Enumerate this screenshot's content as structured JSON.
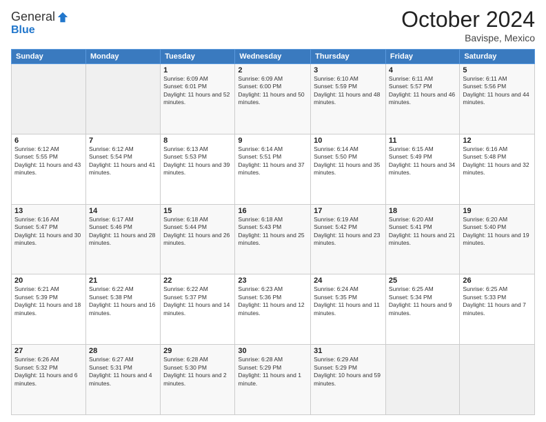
{
  "header": {
    "logo_general": "General",
    "logo_blue": "Blue",
    "month": "October 2024",
    "location": "Bavispe, Mexico"
  },
  "days_of_week": [
    "Sunday",
    "Monday",
    "Tuesday",
    "Wednesday",
    "Thursday",
    "Friday",
    "Saturday"
  ],
  "weeks": [
    [
      {
        "day": "",
        "sunrise": "",
        "sunset": "",
        "daylight": ""
      },
      {
        "day": "",
        "sunrise": "",
        "sunset": "",
        "daylight": ""
      },
      {
        "day": "1",
        "sunrise": "Sunrise: 6:09 AM",
        "sunset": "Sunset: 6:01 PM",
        "daylight": "Daylight: 11 hours and 52 minutes."
      },
      {
        "day": "2",
        "sunrise": "Sunrise: 6:09 AM",
        "sunset": "Sunset: 6:00 PM",
        "daylight": "Daylight: 11 hours and 50 minutes."
      },
      {
        "day": "3",
        "sunrise": "Sunrise: 6:10 AM",
        "sunset": "Sunset: 5:59 PM",
        "daylight": "Daylight: 11 hours and 48 minutes."
      },
      {
        "day": "4",
        "sunrise": "Sunrise: 6:11 AM",
        "sunset": "Sunset: 5:57 PM",
        "daylight": "Daylight: 11 hours and 46 minutes."
      },
      {
        "day": "5",
        "sunrise": "Sunrise: 6:11 AM",
        "sunset": "Sunset: 5:56 PM",
        "daylight": "Daylight: 11 hours and 44 minutes."
      }
    ],
    [
      {
        "day": "6",
        "sunrise": "Sunrise: 6:12 AM",
        "sunset": "Sunset: 5:55 PM",
        "daylight": "Daylight: 11 hours and 43 minutes."
      },
      {
        "day": "7",
        "sunrise": "Sunrise: 6:12 AM",
        "sunset": "Sunset: 5:54 PM",
        "daylight": "Daylight: 11 hours and 41 minutes."
      },
      {
        "day": "8",
        "sunrise": "Sunrise: 6:13 AM",
        "sunset": "Sunset: 5:53 PM",
        "daylight": "Daylight: 11 hours and 39 minutes."
      },
      {
        "day": "9",
        "sunrise": "Sunrise: 6:14 AM",
        "sunset": "Sunset: 5:51 PM",
        "daylight": "Daylight: 11 hours and 37 minutes."
      },
      {
        "day": "10",
        "sunrise": "Sunrise: 6:14 AM",
        "sunset": "Sunset: 5:50 PM",
        "daylight": "Daylight: 11 hours and 35 minutes."
      },
      {
        "day": "11",
        "sunrise": "Sunrise: 6:15 AM",
        "sunset": "Sunset: 5:49 PM",
        "daylight": "Daylight: 11 hours and 34 minutes."
      },
      {
        "day": "12",
        "sunrise": "Sunrise: 6:16 AM",
        "sunset": "Sunset: 5:48 PM",
        "daylight": "Daylight: 11 hours and 32 minutes."
      }
    ],
    [
      {
        "day": "13",
        "sunrise": "Sunrise: 6:16 AM",
        "sunset": "Sunset: 5:47 PM",
        "daylight": "Daylight: 11 hours and 30 minutes."
      },
      {
        "day": "14",
        "sunrise": "Sunrise: 6:17 AM",
        "sunset": "Sunset: 5:46 PM",
        "daylight": "Daylight: 11 hours and 28 minutes."
      },
      {
        "day": "15",
        "sunrise": "Sunrise: 6:18 AM",
        "sunset": "Sunset: 5:44 PM",
        "daylight": "Daylight: 11 hours and 26 minutes."
      },
      {
        "day": "16",
        "sunrise": "Sunrise: 6:18 AM",
        "sunset": "Sunset: 5:43 PM",
        "daylight": "Daylight: 11 hours and 25 minutes."
      },
      {
        "day": "17",
        "sunrise": "Sunrise: 6:19 AM",
        "sunset": "Sunset: 5:42 PM",
        "daylight": "Daylight: 11 hours and 23 minutes."
      },
      {
        "day": "18",
        "sunrise": "Sunrise: 6:20 AM",
        "sunset": "Sunset: 5:41 PM",
        "daylight": "Daylight: 11 hours and 21 minutes."
      },
      {
        "day": "19",
        "sunrise": "Sunrise: 6:20 AM",
        "sunset": "Sunset: 5:40 PM",
        "daylight": "Daylight: 11 hours and 19 minutes."
      }
    ],
    [
      {
        "day": "20",
        "sunrise": "Sunrise: 6:21 AM",
        "sunset": "Sunset: 5:39 PM",
        "daylight": "Daylight: 11 hours and 18 minutes."
      },
      {
        "day": "21",
        "sunrise": "Sunrise: 6:22 AM",
        "sunset": "Sunset: 5:38 PM",
        "daylight": "Daylight: 11 hours and 16 minutes."
      },
      {
        "day": "22",
        "sunrise": "Sunrise: 6:22 AM",
        "sunset": "Sunset: 5:37 PM",
        "daylight": "Daylight: 11 hours and 14 minutes."
      },
      {
        "day": "23",
        "sunrise": "Sunrise: 6:23 AM",
        "sunset": "Sunset: 5:36 PM",
        "daylight": "Daylight: 11 hours and 12 minutes."
      },
      {
        "day": "24",
        "sunrise": "Sunrise: 6:24 AM",
        "sunset": "Sunset: 5:35 PM",
        "daylight": "Daylight: 11 hours and 11 minutes."
      },
      {
        "day": "25",
        "sunrise": "Sunrise: 6:25 AM",
        "sunset": "Sunset: 5:34 PM",
        "daylight": "Daylight: 11 hours and 9 minutes."
      },
      {
        "day": "26",
        "sunrise": "Sunrise: 6:25 AM",
        "sunset": "Sunset: 5:33 PM",
        "daylight": "Daylight: 11 hours and 7 minutes."
      }
    ],
    [
      {
        "day": "27",
        "sunrise": "Sunrise: 6:26 AM",
        "sunset": "Sunset: 5:32 PM",
        "daylight": "Daylight: 11 hours and 6 minutes."
      },
      {
        "day": "28",
        "sunrise": "Sunrise: 6:27 AM",
        "sunset": "Sunset: 5:31 PM",
        "daylight": "Daylight: 11 hours and 4 minutes."
      },
      {
        "day": "29",
        "sunrise": "Sunrise: 6:28 AM",
        "sunset": "Sunset: 5:30 PM",
        "daylight": "Daylight: 11 hours and 2 minutes."
      },
      {
        "day": "30",
        "sunrise": "Sunrise: 6:28 AM",
        "sunset": "Sunset: 5:29 PM",
        "daylight": "Daylight: 11 hours and 1 minute."
      },
      {
        "day": "31",
        "sunrise": "Sunrise: 6:29 AM",
        "sunset": "Sunset: 5:29 PM",
        "daylight": "Daylight: 10 hours and 59 minutes."
      },
      {
        "day": "",
        "sunrise": "",
        "sunset": "",
        "daylight": ""
      },
      {
        "day": "",
        "sunrise": "",
        "sunset": "",
        "daylight": ""
      }
    ]
  ]
}
